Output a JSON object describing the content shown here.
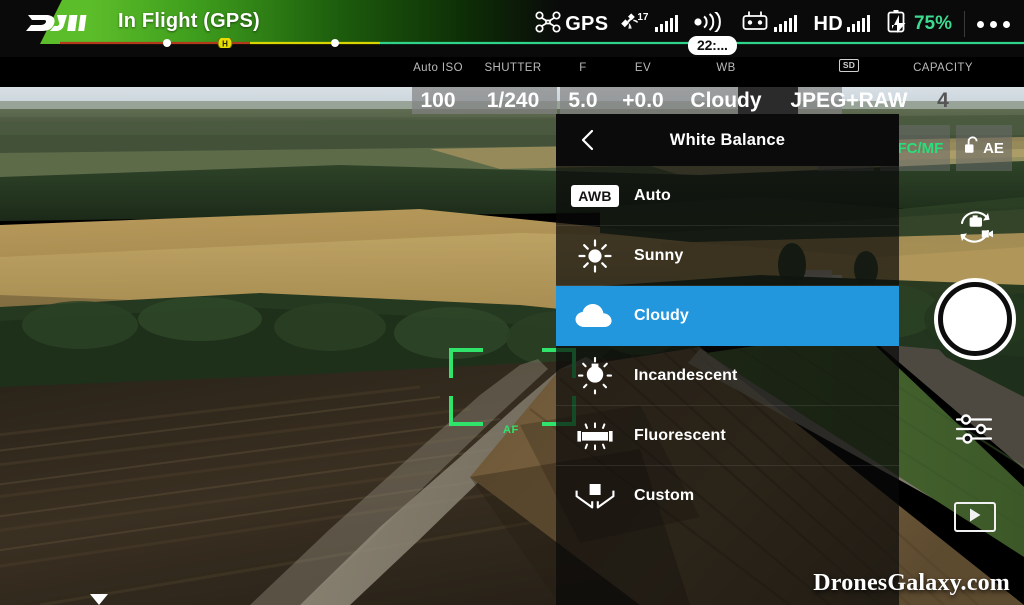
{
  "app": {
    "brand": "dji",
    "flight_status": "In Flight (GPS)",
    "watermark": "DronesGalaxy.com"
  },
  "status_bar": {
    "gps_label": "GPS",
    "satellite_count": "17",
    "flight_time": "22:...",
    "video_quality": "HD",
    "battery_percent": "75%",
    "icons": {
      "drone": "drone-icon",
      "satellite": "satellite-icon",
      "signal_bars": "signal-bars-icon",
      "rc_transmission": "rc-transmission-icon",
      "remote_controller": "remote-controller-icon",
      "hd_signal": "hd-signal-icon",
      "battery": "battery-icon",
      "more": "more-options-icon"
    }
  },
  "camera_settings": {
    "fields": [
      {
        "caption": "Auto ISO",
        "value": "100"
      },
      {
        "caption": "SHUTTER",
        "value": "1/240"
      },
      {
        "caption": "F",
        "value": "5.0"
      },
      {
        "caption": "EV",
        "value": "+0.0"
      },
      {
        "caption": "WB",
        "value": "Cloudy"
      },
      {
        "caption": "SD",
        "value": "JPEG+RAW"
      },
      {
        "caption": "CAPACITY",
        "value": "4"
      }
    ],
    "af_box_button": "af-box-icon",
    "focus_mode": "AFC/MF",
    "exposure_lock": "AE"
  },
  "white_balance_panel": {
    "title": "White Balance",
    "back_icon": "chevron-left-icon",
    "selected": "Cloudy",
    "items": [
      {
        "label": "Auto",
        "icon": "awb-badge-icon",
        "badge": "AWB",
        "selected": false
      },
      {
        "label": "Sunny",
        "icon": "sun-icon",
        "badge": "",
        "selected": false
      },
      {
        "label": "Cloudy",
        "icon": "cloud-icon",
        "badge": "",
        "selected": true
      },
      {
        "label": "Incandescent",
        "icon": "lightbulb-icon",
        "badge": "",
        "selected": false
      },
      {
        "label": "Fluorescent",
        "icon": "fluorescent-icon",
        "badge": "",
        "selected": false
      },
      {
        "label": "Custom",
        "icon": "custom-wb-icon",
        "badge": "",
        "selected": false
      }
    ]
  },
  "right_controls": {
    "switch_camera": "switch-camera-icon",
    "shutter": "shutter-button",
    "camera_settings": "camera-settings-sliders-icon",
    "playback": "playback-icon"
  },
  "viewfinder": {
    "af_label": "AF"
  },
  "colors": {
    "accent_blue": "#2397dd",
    "status_green": "#3ddb8f",
    "af_green": "#2fe36b",
    "banner_green": "#5cbd2a",
    "focus_mode_green": "#27e07a"
  }
}
